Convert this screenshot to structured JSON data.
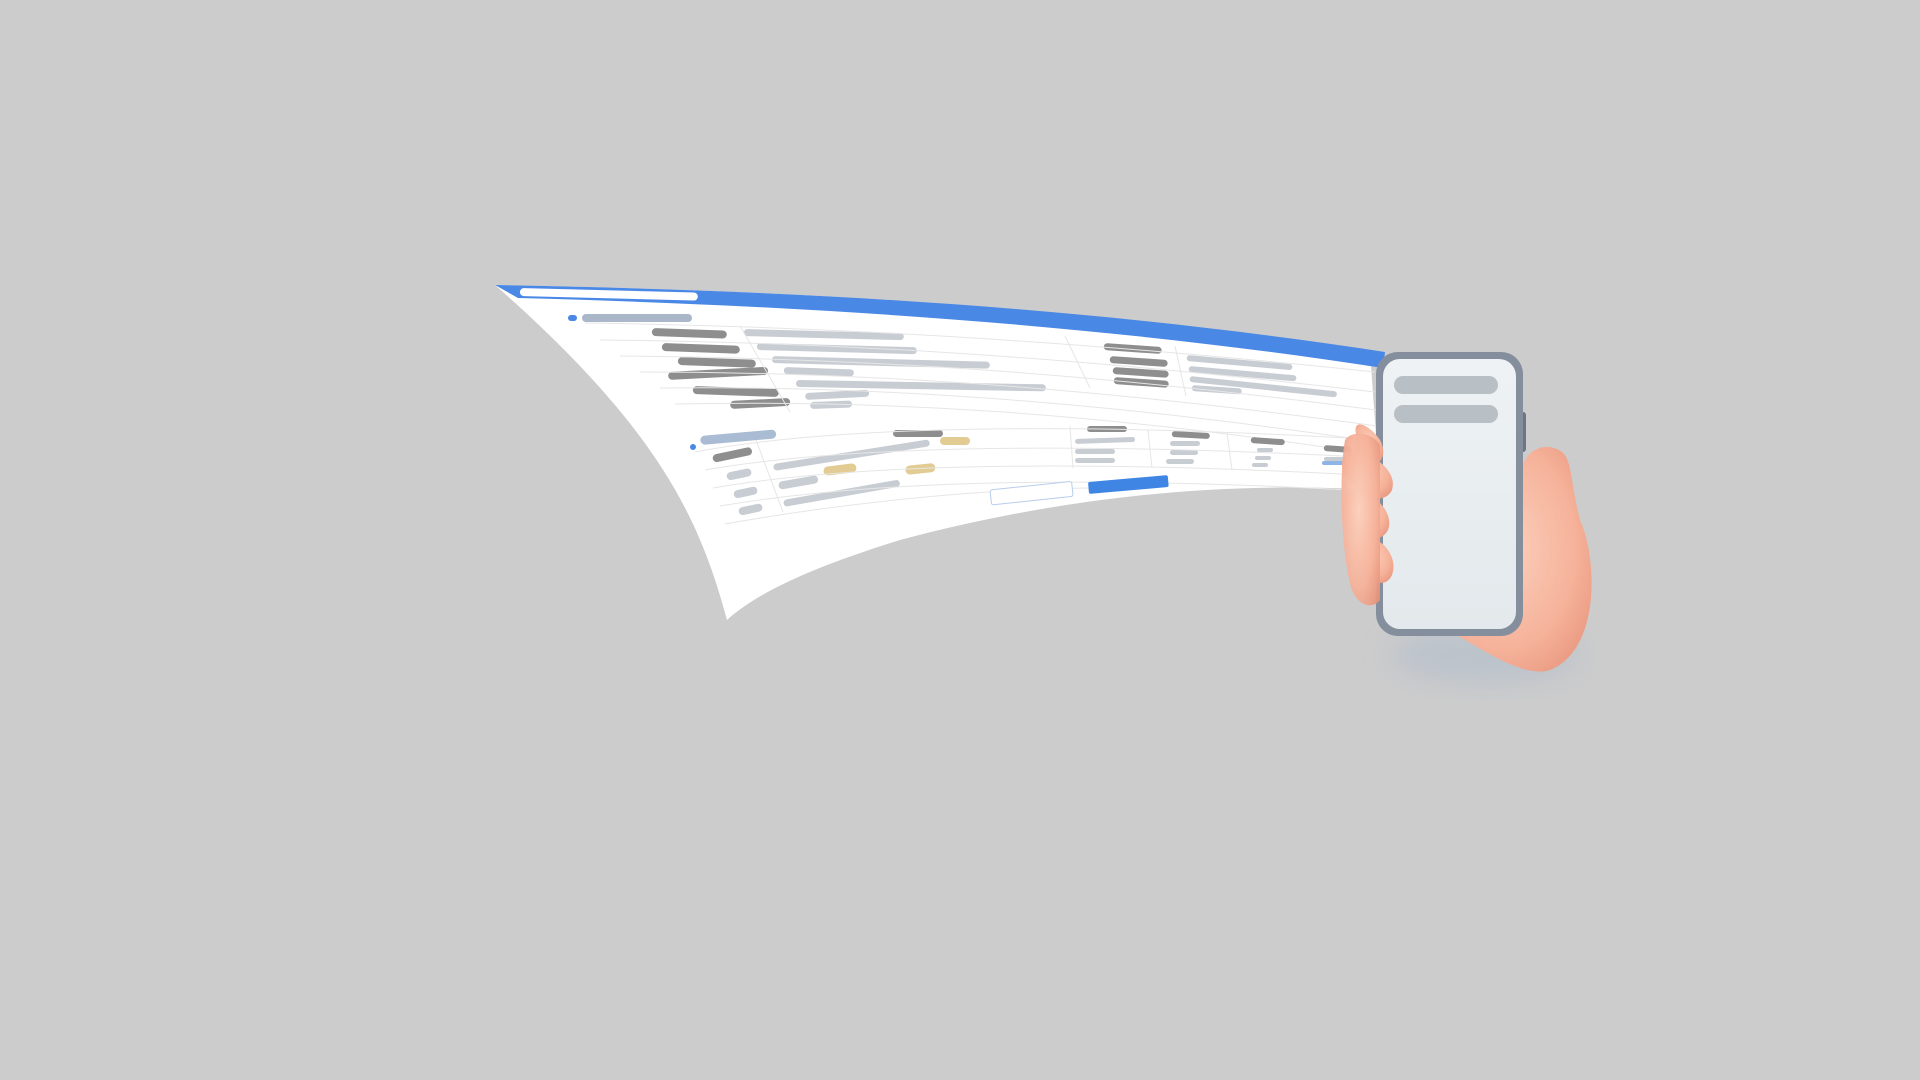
{
  "colors": {
    "background": "#cccccc",
    "header_bar": "#4a88e6",
    "primary_button": "#3f86e4",
    "placeholder_dark": "#8e8e8e",
    "placeholder_light": "#c8cdd4",
    "placeholder_blue": "#a9bcd4",
    "placeholder_yellow": "#e2cc94",
    "phone_frame": "#8690a0",
    "phone_screen": "#e9eef0",
    "skin": "#f6b29a"
  },
  "illustration": {
    "document": {
      "header": "header-bar",
      "sections": 2,
      "buttons": [
        "secondary-button",
        "primary-button"
      ]
    },
    "phone": {
      "screen_rows": 2
    },
    "icons": [
      "hand-icon",
      "smartphone-icon"
    ]
  }
}
